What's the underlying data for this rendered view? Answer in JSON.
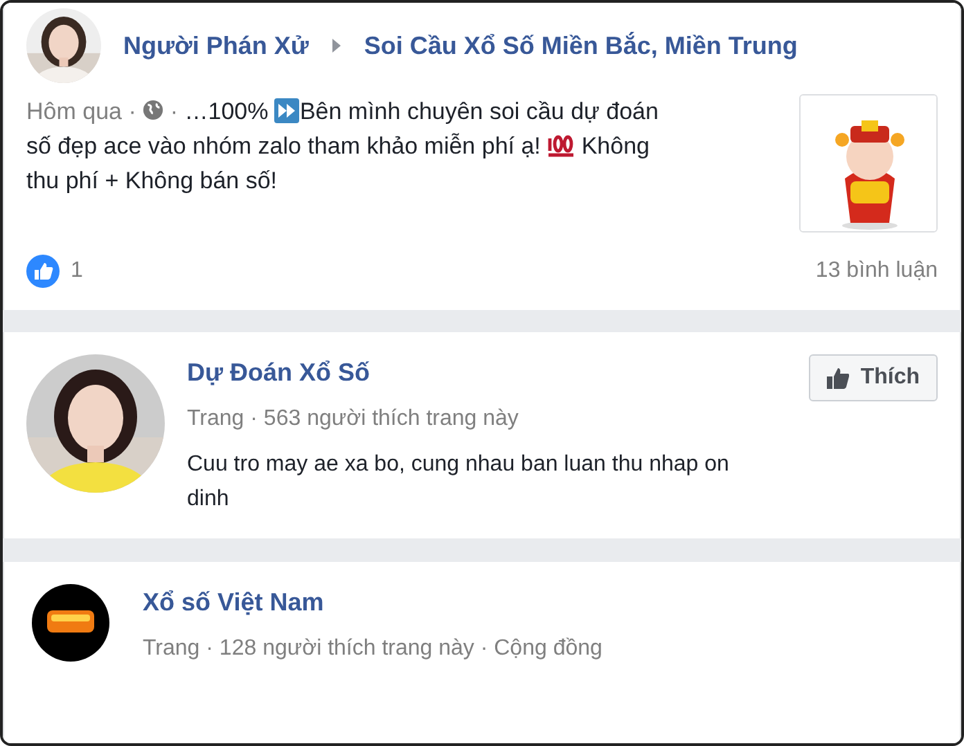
{
  "post": {
    "author": "Người Phán Xử",
    "group": "Soi Cầu Xổ Số Miền Bắc, Miền Trung",
    "time": "Hôm qua ·",
    "separator": "·",
    "body": [
      [
        {
          "kind": "text",
          "text": "…100% "
        },
        {
          "kind": "fast-forward"
        },
        {
          "kind": "text",
          "text": "Bên mình chuyên soi cầu dự đoán"
        }
      ],
      [
        {
          "kind": "text",
          "text": "số đẹp ace vào nhóm zalo tham khảo miễn phí ạ! "
        },
        {
          "kind": "hundred"
        },
        {
          "kind": "text",
          "text": " Không"
        }
      ],
      [
        {
          "kind": "text",
          "text": "thu phí + Không bán số!"
        }
      ]
    ],
    "likes": "1",
    "comments": "13 bình luận"
  },
  "pages": [
    {
      "name": "Dự Đoán Xổ Số",
      "meta": "Trang · 563 người thích trang này",
      "description": "Cuu tro may ae xa bo, cung nhau ban luan thu nhap on dinh",
      "like_button": "Thích"
    },
    {
      "name": "Xổ số Việt Nam",
      "meta": "Trang · 128 người thích trang này · Cộng đồng"
    }
  ]
}
